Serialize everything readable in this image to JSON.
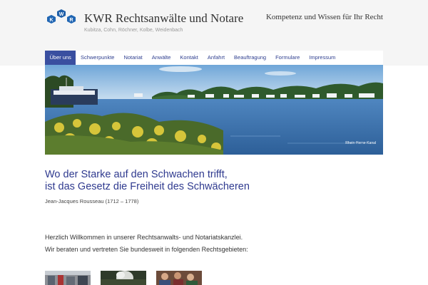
{
  "header": {
    "title": "KWR Rechtsanwälte und Notare",
    "subtitle": "Kubitza, Cohn, Röchner, Kolbe, Weidenbach",
    "tagline": "Kompetenz und Wissen für Ihr Recht",
    "logo_letters": [
      "K",
      "W",
      "R"
    ]
  },
  "nav": {
    "items": [
      "Über uns",
      "Schwerpunkte",
      "Notariat",
      "Anwälte",
      "Kontakt",
      "Anfahrt",
      "Beauftragung",
      "Formulare",
      "Impressum"
    ],
    "active_index": 0
  },
  "banner": {
    "caption": "Rhein-Herne-Kanal"
  },
  "quote": {
    "line1": "Wo der Starke auf den Schwachen trifft,",
    "line2": "ist das Gesetz die Freiheit des Schwächeren",
    "author": "Jean-Jacques Rousseau (1712 – 1778)"
  },
  "content": {
    "welcome": "Herzlich Willkommen in unserer Rechtsanwalts- und Notariatskanzlei.",
    "services_intro": "Wir beraten und vertreten Sie bundesweit in folgenden Rechtsgebieten:"
  },
  "colors": {
    "accent": "#3a4fa0",
    "quote": "#2f3a8f",
    "logo_hex": "#1f5fa8",
    "header_bg": "#f5f5f5"
  }
}
